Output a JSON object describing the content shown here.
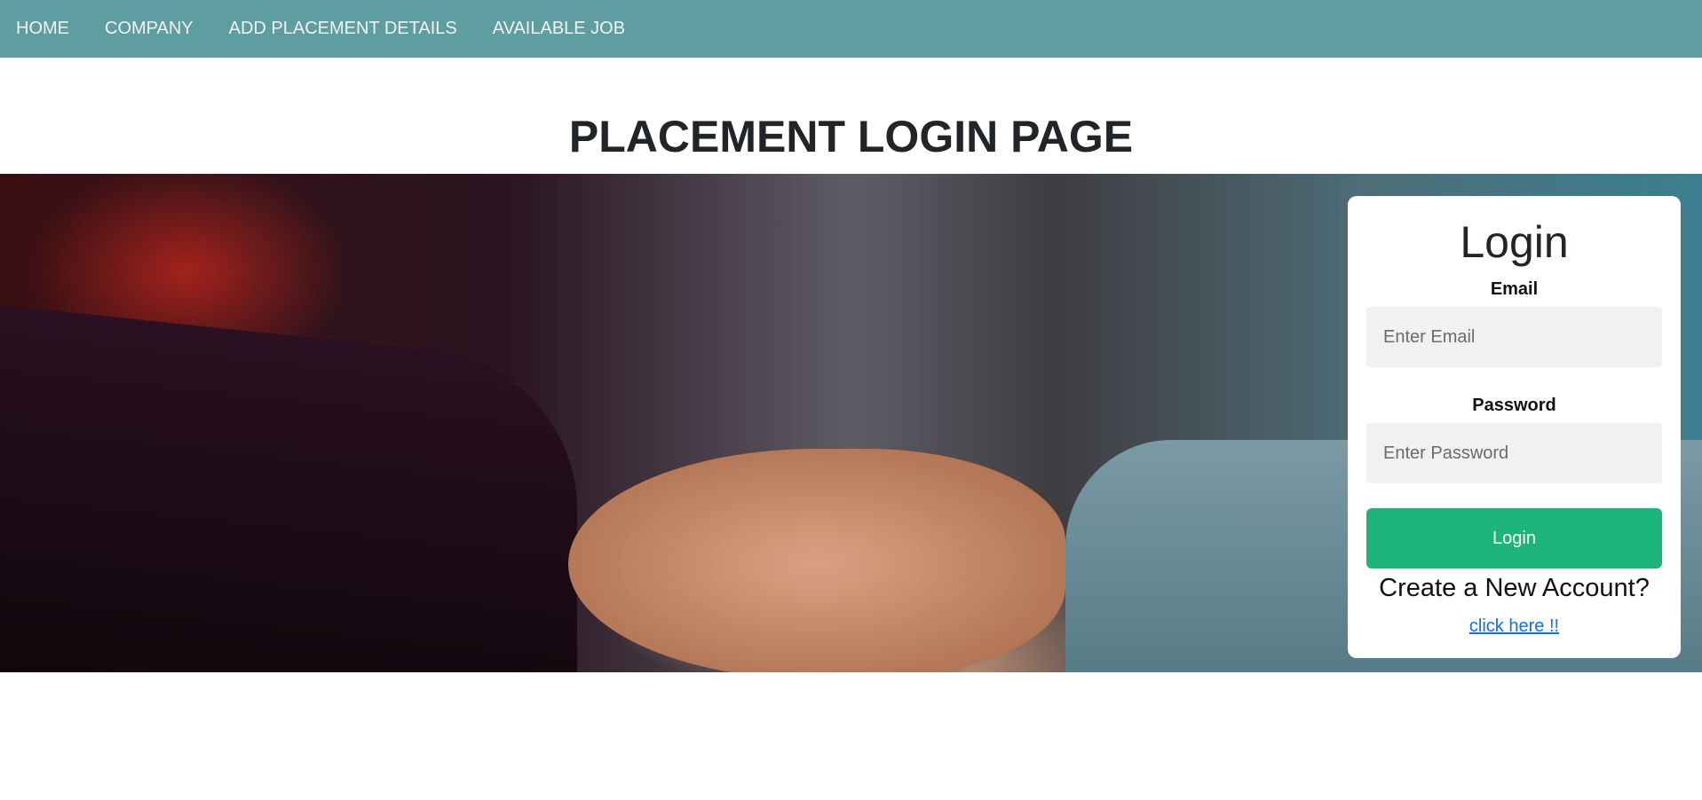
{
  "nav": {
    "items": [
      "HOME",
      "COMPANY",
      "ADD PLACEMENT DETAILS",
      "AVAILABLE JOB"
    ]
  },
  "page_title": "PLACEMENT LOGIN PAGE",
  "login": {
    "heading": "Login",
    "email_label": "Email",
    "email_placeholder": "Enter Email",
    "password_label": "Password",
    "password_placeholder": "Enter Password",
    "button": "Login",
    "create_text": "Create a New Account?",
    "link_text": "click here !!"
  },
  "colors": {
    "nav": "#5f9ea0",
    "button": "#1db37c",
    "link": "#0d6efd"
  }
}
